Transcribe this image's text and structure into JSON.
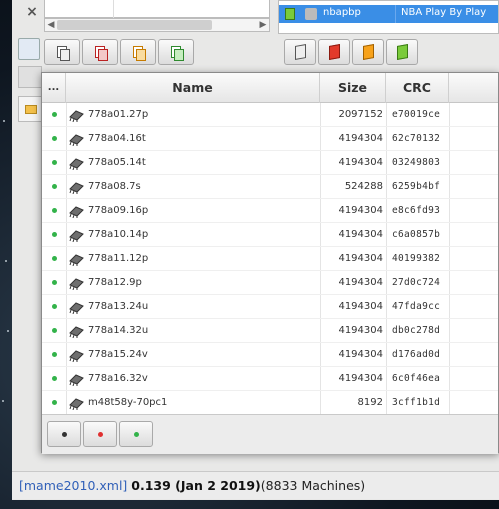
{
  "window": {
    "close_glyph": "×"
  },
  "right_list": {
    "selected_row": {
      "name": "nbapbp",
      "description": "NBA Play By Play"
    }
  },
  "dialog": {
    "columns": {
      "status": "...",
      "name": "Name",
      "size": "Size",
      "crc": "CRC"
    },
    "rows": [
      {
        "name": "778a01.27p",
        "size": "2097152",
        "crc": "e70019ce",
        "status": "green"
      },
      {
        "name": "778a04.16t",
        "size": "4194304",
        "crc": "62c70132",
        "status": "green"
      },
      {
        "name": "778a05.14t",
        "size": "4194304",
        "crc": "03249803",
        "status": "green"
      },
      {
        "name": "778a08.7s",
        "size": "524288",
        "crc": "6259b4bf",
        "status": "green"
      },
      {
        "name": "778a09.16p",
        "size": "4194304",
        "crc": "e8c6fd93",
        "status": "green"
      },
      {
        "name": "778a10.14p",
        "size": "4194304",
        "crc": "c6a0857b",
        "status": "green"
      },
      {
        "name": "778a11.12p",
        "size": "4194304",
        "crc": "40199382",
        "status": "green"
      },
      {
        "name": "778a12.9p",
        "size": "4194304",
        "crc": "27d0c724",
        "status": "green"
      },
      {
        "name": "778a13.24u",
        "size": "4194304",
        "crc": "47fda9cc",
        "status": "green"
      },
      {
        "name": "778a14.32u",
        "size": "4194304",
        "crc": "db0c278d",
        "status": "green"
      },
      {
        "name": "778a15.24v",
        "size": "4194304",
        "crc": "d176ad0d",
        "status": "green"
      },
      {
        "name": "778a16.32v",
        "size": "4194304",
        "crc": "6c0f46ea",
        "status": "green"
      },
      {
        "name": "m48t58y-70pc1",
        "size": "8192",
        "crc": "3cff1b1d",
        "status": "green"
      }
    ],
    "footer_buttons": [
      {
        "name": "filter-unknown-button",
        "color": "#333333"
      },
      {
        "name": "filter-missing-button",
        "color": "#e03030"
      },
      {
        "name": "filter-ok-button",
        "color": "#33b34a"
      }
    ]
  },
  "status_bar": {
    "dat_file": "[mame2010.xml]",
    "version": "0.139 (Jan  2 2019)",
    "machines": "(8833 Machines)"
  },
  "colors": {
    "selection": "#3a8ee6",
    "ok_dot": "#33b34a",
    "link": "#3160b8"
  }
}
